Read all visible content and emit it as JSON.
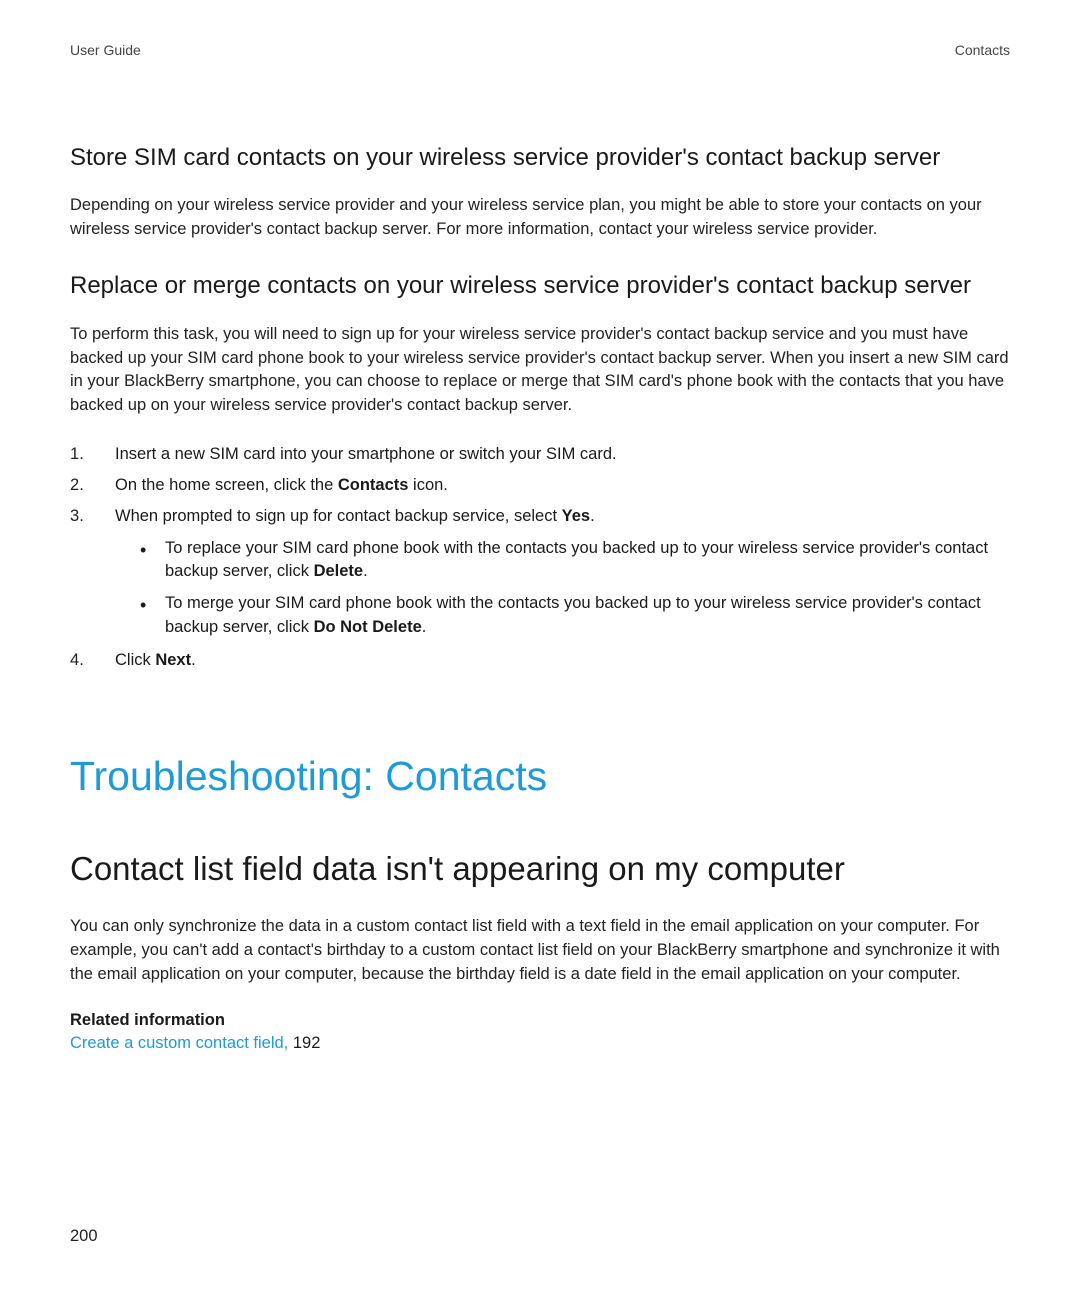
{
  "header": {
    "left": "User Guide",
    "right": "Contacts"
  },
  "section1": {
    "heading": "Store SIM card contacts on your wireless service provider's contact backup server",
    "body": "Depending on your wireless service provider and your wireless service plan, you might be able to store your contacts on your wireless service provider's contact backup server. For more information, contact your wireless service provider."
  },
  "section2": {
    "heading": "Replace or merge contacts on your wireless service provider's contact backup server",
    "body": "To perform this task, you will need to sign up for your wireless service provider's contact backup service and you must have backed up your SIM card phone book to your wireless service provider's contact backup server. When you insert a new SIM card in your BlackBerry smartphone, you can choose to replace or merge that SIM card's phone book with the contacts that you have backed up on your wireless service provider's contact backup server.",
    "steps": {
      "s1": "Insert a new SIM card into your smartphone or switch your SIM card.",
      "s2_pre": "On the home screen, click the ",
      "s2_bold": "Contacts",
      "s2_post": " icon.",
      "s3_pre": "When prompted to sign up for contact backup service, select ",
      "s3_bold": "Yes",
      "s3_post": ".",
      "bullets": {
        "b1_pre": "To replace your SIM card phone book with the contacts you backed up to your wireless service provider's contact backup server, click ",
        "b1_bold": "Delete",
        "b1_post": ".",
        "b2_pre": "To merge your SIM card phone book with the contacts you backed up to your wireless service provider's contact backup server, click ",
        "b2_bold": "Do Not Delete",
        "b2_post": "."
      },
      "s4_pre": "Click ",
      "s4_bold": "Next",
      "s4_post": "."
    }
  },
  "h1": "Troubleshooting: Contacts",
  "h2": "Contact list field data isn't appearing on my computer",
  "troubleshoot_body": "You can only synchronize the data in a custom contact list field with a text field in the email application on your computer. For example, you can't add a contact's birthday to a custom contact list field on your BlackBerry smartphone and synchronize it with the email application on your computer, because the birthday field is a date field in the email application on your computer.",
  "related": {
    "heading": "Related information",
    "link_text": "Create a custom contact field,",
    "link_page": " 192"
  },
  "page_number": "200"
}
